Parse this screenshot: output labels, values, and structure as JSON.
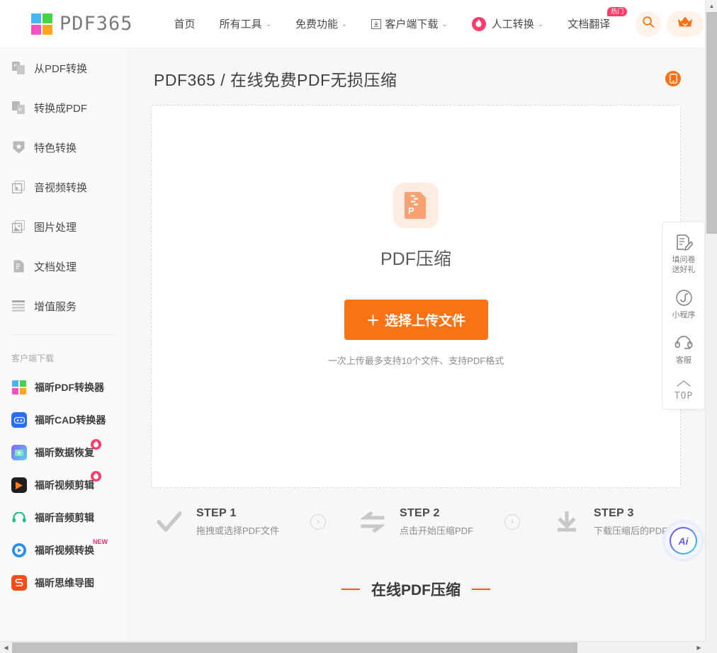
{
  "brand": {
    "name": "PDF365",
    "logo_colors": [
      "#4ab3f4",
      "#4ad14a",
      "#f74fc0",
      "#ffa41b"
    ]
  },
  "topnav": {
    "items": [
      {
        "label": "首页",
        "caret": false,
        "icon": null,
        "badge": null
      },
      {
        "label": "所有工具",
        "caret": true,
        "icon": null,
        "badge": null
      },
      {
        "label": "免费功能",
        "caret": true,
        "icon": null,
        "badge": null
      },
      {
        "label": "客户端下载",
        "caret": true,
        "icon": "download-icon",
        "badge": null
      },
      {
        "label": "人工转换",
        "caret": true,
        "icon": "flame-icon",
        "badge": null
      },
      {
        "label": "文档翻译",
        "caret": false,
        "icon": null,
        "badge": "热门"
      }
    ],
    "search_icon": "search-icon",
    "vip_icon": "crown-icon"
  },
  "sidebar": {
    "items": [
      {
        "label": "从PDF转换",
        "icon": "from-pdf-icon"
      },
      {
        "label": "转换成PDF",
        "icon": "to-pdf-icon"
      },
      {
        "label": "特色转换",
        "icon": "shield-star-icon"
      },
      {
        "label": "音视频转换",
        "icon": "video-icon"
      },
      {
        "label": "图片处理",
        "icon": "image-icon"
      },
      {
        "label": "文档处理",
        "icon": "document-icon"
      },
      {
        "label": "增值服务",
        "icon": "list-icon"
      }
    ],
    "section_title": "客户端下载",
    "apps": [
      {
        "label": "福昕PDF转换器",
        "icon": "pdf365-app-icon",
        "color": "#ffffff",
        "badge": null
      },
      {
        "label": "福昕CAD转换器",
        "icon": "cad-app-icon",
        "color": "#2a6ef5",
        "badge": null
      },
      {
        "label": "福昕数据恢复",
        "icon": "data-recovery-app-icon",
        "color": "#8a63f5",
        "badge": null
      },
      {
        "label": "福昕视频剪辑",
        "icon": "video-editor-app-icon",
        "color": "#1f1f1f",
        "badge": "flame"
      },
      {
        "label": "福昕音频剪辑",
        "icon": "audio-editor-app-icon",
        "color": "#ffffff",
        "badge": null
      },
      {
        "label": "福昕视频转换",
        "icon": "video-convert-app-icon",
        "color": "#1f7ae0",
        "badge": "NEW"
      },
      {
        "label": "福昕思维导图",
        "icon": "mindmap-app-icon",
        "color": "#f24d17",
        "badge": null
      }
    ]
  },
  "main": {
    "page_title": "PDF365 / 在线免费PDF无损压缩",
    "mobile_icon": "mobile-icon",
    "tool_name": "PDF压缩",
    "tool_icon": "pdf-compress-icon",
    "upload_button": "选择上传文件",
    "upload_plus": "＋",
    "upload_hint": "一次上传最多支持10个文件、支持PDF格式",
    "steps": [
      {
        "title": "STEP 1",
        "sub": "拖拽或选择PDF文件",
        "icon": "check-icon"
      },
      {
        "title": "STEP 2",
        "sub": "点击开始压缩PDF",
        "icon": "swap-icon"
      },
      {
        "title": "STEP 3",
        "sub": "下载压缩后的PDF",
        "icon": "download-step-icon"
      }
    ],
    "section_title": "在线PDF压缩"
  },
  "float_panel": {
    "items": [
      {
        "label": "填问卷\n送好礼",
        "line1": "填问卷",
        "line2": "送好礼",
        "icon": "survey-icon"
      },
      {
        "label": "小程序",
        "line1": "小程序",
        "line2": "",
        "icon": "miniprogram-icon"
      },
      {
        "label": "客服",
        "line1": "客服",
        "line2": "",
        "icon": "headset-icon"
      }
    ],
    "top_label": "TOP",
    "top_icon": "chevron-up-icon"
  },
  "ai_button": {
    "label": "Ai",
    "icon": "ai-icon"
  },
  "colors": {
    "accent_orange": "#f97316",
    "hot_pink": "#ff3d68",
    "panel_bg": "#f7f7f7",
    "sidebar_bg": "#fafafa"
  }
}
